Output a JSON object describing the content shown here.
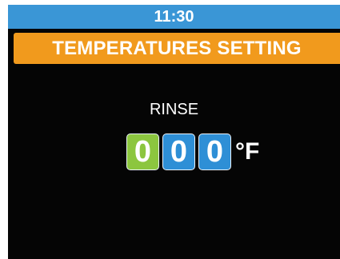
{
  "status_bar": {
    "time": "11:30"
  },
  "header": {
    "title": "TEMPERATURES SETTING"
  },
  "setting": {
    "label": "RINSE",
    "digits": [
      "0",
      "0",
      "0"
    ],
    "unit": "°F"
  },
  "colors": {
    "status_bar": "#3a96d6",
    "title_bar": "#f19a1d",
    "active_digit": "#8cc63f",
    "inactive_digit": "#2e8fd6",
    "background": "#050505"
  }
}
